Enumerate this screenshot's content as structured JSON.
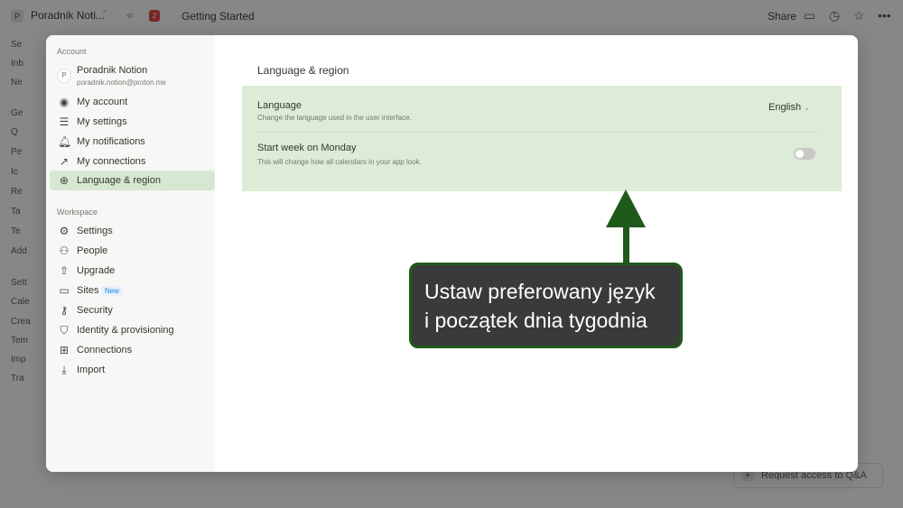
{
  "app": {
    "workspace_initial": "P",
    "workspace_name": "Poradnik Noti...",
    "badge": "2",
    "breadcrumb": "Getting Started",
    "share_label": "Share",
    "request_access": "Request access to Q&A",
    "sidebar_rows": [
      "Se",
      "Inb",
      "Ne",
      "Ge",
      "Q",
      "Pe",
      "Ic",
      "Re",
      "Ta",
      "Te",
      "Add",
      "Sett",
      "Cale",
      "Crea",
      "Tem",
      "Imp",
      "Tra"
    ]
  },
  "modal": {
    "account_label": "Account",
    "profile": {
      "initial": "P",
      "name": "Poradnik Notion",
      "email": "poradnik.notion@proton.me"
    },
    "account_items": [
      {
        "label": "My account",
        "icon": "account-icon"
      },
      {
        "label": "My settings",
        "icon": "sliders-icon"
      },
      {
        "label": "My notifications",
        "icon": "bell-icon"
      },
      {
        "label": "My connections",
        "icon": "external-link-icon"
      },
      {
        "label": "Language & region",
        "icon": "globe-icon"
      }
    ],
    "workspace_label": "Workspace",
    "workspace_items": [
      {
        "label": "Settings",
        "icon": "gear-icon"
      },
      {
        "label": "People",
        "icon": "people-icon"
      },
      {
        "label": "Upgrade",
        "icon": "upgrade-icon"
      },
      {
        "label": "Sites",
        "icon": "sites-icon",
        "tag": "New"
      },
      {
        "label": "Security",
        "icon": "key-icon"
      },
      {
        "label": "Identity & provisioning",
        "icon": "shield-icon"
      },
      {
        "label": "Connections",
        "icon": "grid-icon"
      },
      {
        "label": "Import",
        "icon": "download-icon"
      }
    ],
    "content": {
      "title": "Language & region",
      "language": {
        "title": "Language",
        "desc": "Change the language used in the user interface.",
        "value": "English"
      },
      "week_start": {
        "title": "Start week on Monday",
        "desc": "This will change how all calendars in your app look.",
        "enabled": false
      }
    }
  },
  "callout": {
    "line1": "Ustaw preferowany język",
    "line2": "i początek dnia tygodnia"
  },
  "colors": {
    "highlight": "#dcecd7",
    "callout_border": "#1f5a1b",
    "callout_bg": "#3a3a3a"
  }
}
